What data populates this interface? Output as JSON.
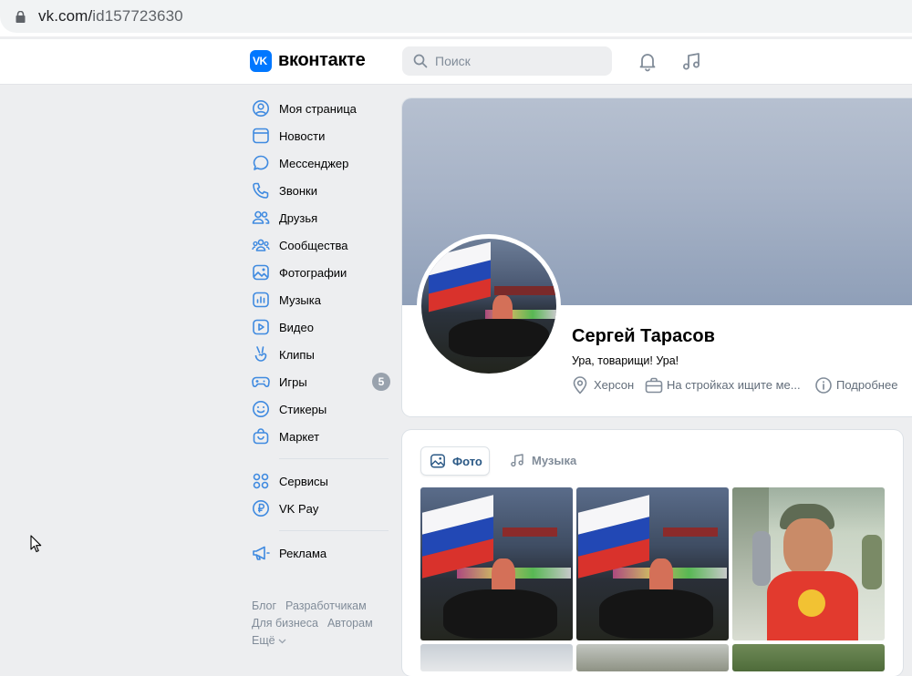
{
  "browser": {
    "url_host": "vk.com/",
    "url_path": "id157723630"
  },
  "header": {
    "logo_text": "вконтакте",
    "search_placeholder": "Поиск"
  },
  "menu": {
    "items": [
      {
        "label": "Моя страница",
        "icon": "user-circle-icon"
      },
      {
        "label": "Новости",
        "icon": "news-icon"
      },
      {
        "label": "Мессенджер",
        "icon": "message-icon"
      },
      {
        "label": "Звонки",
        "icon": "phone-icon"
      },
      {
        "label": "Друзья",
        "icon": "friends-icon"
      },
      {
        "label": "Сообщества",
        "icon": "communities-icon"
      },
      {
        "label": "Фотографии",
        "icon": "photo-icon"
      },
      {
        "label": "Музыка",
        "icon": "music-icon"
      },
      {
        "label": "Видео",
        "icon": "video-icon"
      },
      {
        "label": "Клипы",
        "icon": "clips-icon"
      },
      {
        "label": "Игры",
        "icon": "games-icon",
        "badge": "5"
      },
      {
        "label": "Стикеры",
        "icon": "smile-icon"
      },
      {
        "label": "Маркет",
        "icon": "market-icon"
      }
    ],
    "services": [
      {
        "label": "Сервисы",
        "icon": "services-icon"
      },
      {
        "label": "VK Pay",
        "icon": "vkpay-icon"
      }
    ],
    "ads": {
      "label": "Реклама",
      "icon": "megaphone-icon"
    },
    "footer": [
      "Блог",
      "Разработчикам",
      "Для бизнеса",
      "Авторам",
      "Ещё"
    ]
  },
  "profile": {
    "name": "Сергей Тарасов",
    "status": "Ура, товарищи! Ура!",
    "city": "Херсон",
    "work": "На стройках ищите ме...",
    "more": "Подробнее"
  },
  "media": {
    "tabs": [
      {
        "label": "Фото",
        "active": true
      },
      {
        "label": "Музыка",
        "active": false
      }
    ]
  },
  "colors": {
    "accent": "#0077ff",
    "link": "#2a5885",
    "muted": "#818c99",
    "icon": "#3f8ae0"
  }
}
